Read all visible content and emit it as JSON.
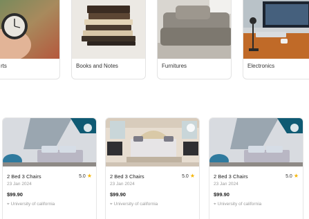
{
  "categories": [
    {
      "label": "rts",
      "icon": "clock-photo"
    },
    {
      "label": "Books and Notes",
      "icon": "books-photo"
    },
    {
      "label": "Furnitures",
      "icon": "sofa-photo"
    },
    {
      "label": "Electronics",
      "icon": "desk-setup-photo"
    }
  ],
  "listings": [
    {
      "title": "2 Bed 3 Chairs",
      "rating": "5.0",
      "date": "23 Jan 2024",
      "price": "$99.90",
      "location": "University of california"
    },
    {
      "title": "2 Bed 3 Chairs",
      "rating": "5.0",
      "date": "23 Jan 2024",
      "price": "$99.90",
      "location": "University of california"
    },
    {
      "title": "2 Bed 3 Chairs",
      "rating": "5.0",
      "date": "23 Jan 2024",
      "price": "$99.90",
      "location": "University of california"
    }
  ],
  "colors": {
    "star": "#f5b400",
    "muted_text": "#9a9a9a",
    "border": "#e3e3e3"
  }
}
